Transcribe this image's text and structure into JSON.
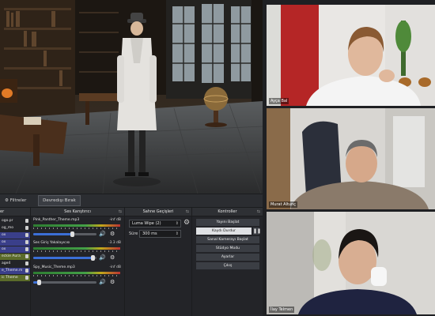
{
  "obs": {
    "tabs": {
      "filters": "Filtreler",
      "deactivate": "Devredışı Bırak"
    },
    "panels": {
      "sources_title": "er",
      "mixer_title": "Ses Karıştırıcı",
      "transitions_title": "Sahne Geçişleri",
      "controls_title": "Kontroller"
    },
    "sources": [
      {
        "label": "ogo.pr"
      },
      {
        "label": "og_mo"
      },
      {
        "label": "ox"
      },
      {
        "label": "ox"
      },
      {
        "label": "ox"
      },
      {
        "label": "eckie Aura"
      },
      {
        "label": "age4"
      },
      {
        "label": "e_Theme.m"
      },
      {
        "label": "ic Theme"
      }
    ],
    "mixer": [
      {
        "name": "Pink_Panther_Theme.mp3",
        "db": "-inf dB",
        "level": 0.62
      },
      {
        "name": "Ses Giriş Yakalayıcısı",
        "db": "-3.3 dB",
        "level": 0.95
      },
      {
        "name": "Spy_Music_Theme.mp3",
        "db": "-inf dB",
        "level": 0.1
      }
    ],
    "transition": {
      "selected": "Luma Wipe (2)",
      "duration_label": "Süre",
      "duration_value": "300 ms"
    },
    "controls": {
      "start_stream": "Yayını Başlat",
      "stop_recording": "Kaydı Durdur",
      "virtual_camera": "Sanal Kamerayı Başlat",
      "studio_mode": "Stüdyo Modu",
      "settings": "Ayarlar",
      "exit": "Çıkış"
    },
    "icons": {
      "speaker": "speaker-icon",
      "gear": "gear-icon",
      "pause": "pause-icon",
      "lock": "lock-icon",
      "eye": "eye-icon"
    }
  },
  "participants": [
    {
      "name": "Ayça Bal"
    },
    {
      "name": "Murat Altunç"
    },
    {
      "name": "İlay Telmen"
    }
  ],
  "colors": {
    "accent": "#3b6fd6",
    "panel": "#232428",
    "source_highlight": "#3a3f8a"
  }
}
